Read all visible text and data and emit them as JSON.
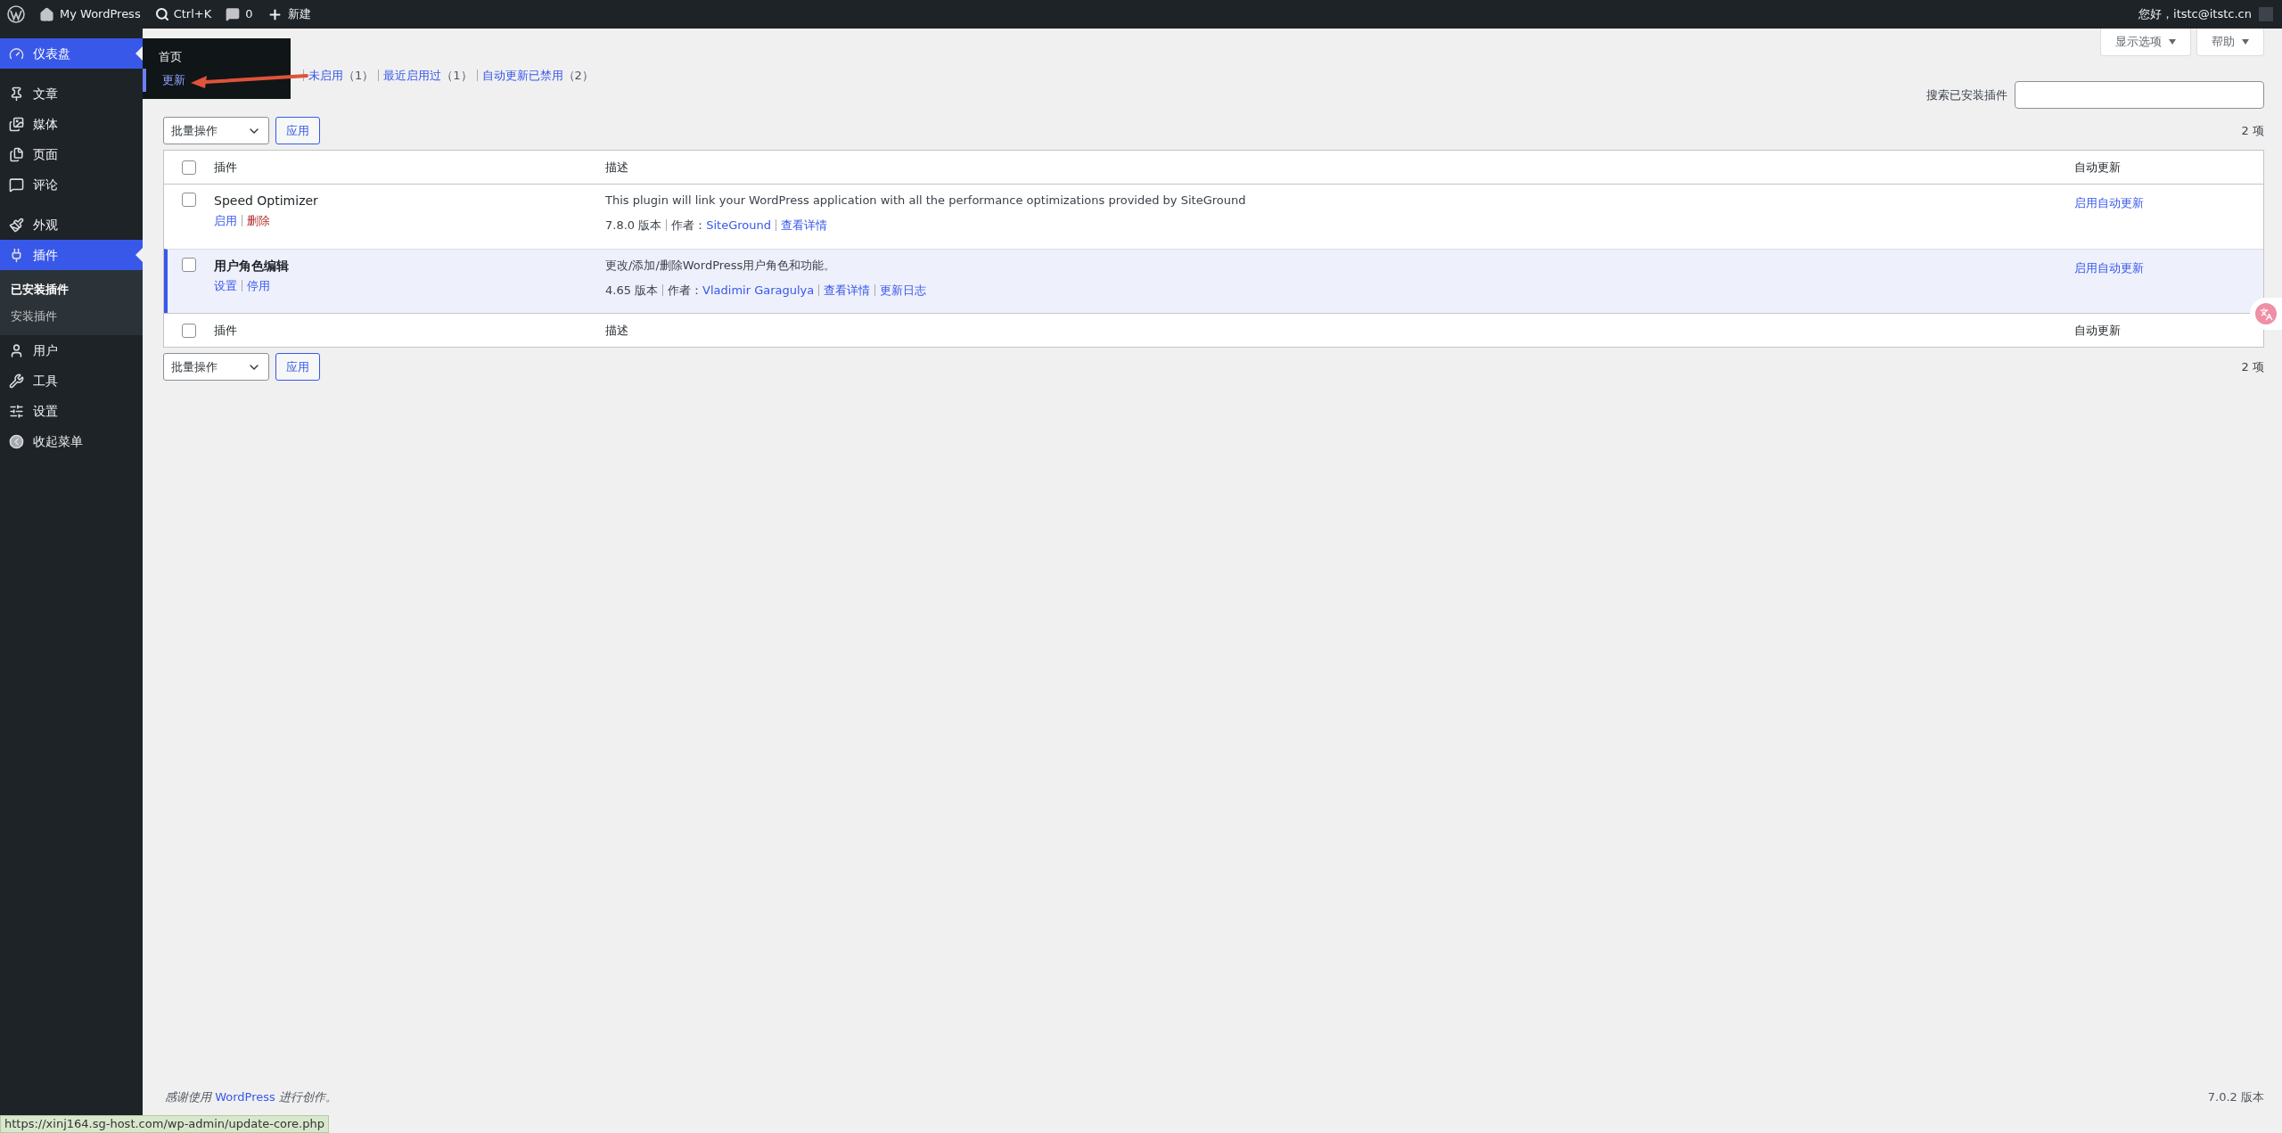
{
  "admin_bar": {
    "site": "My WordPress",
    "search_shortcut": "Ctrl+K",
    "comments": "0",
    "new": "新建",
    "greeting": "您好，itstc@itstc.cn"
  },
  "sidebar": {
    "groups": [
      {
        "items": [
          {
            "label": "仪表盘",
            "highlighted": true
          }
        ]
      },
      {
        "items": [
          {
            "label": "文章",
            "highlighted": false
          },
          {
            "label": "媒体",
            "highlighted": false
          },
          {
            "label": "页面",
            "highlighted": false
          },
          {
            "label": "评论",
            "highlighted": false
          }
        ]
      },
      {
        "items": [
          {
            "label": "外观",
            "highlighted": false
          },
          {
            "label": "插件",
            "highlighted": true,
            "children": [
              {
                "label": "已安装插件",
                "selected": true
              },
              {
                "label": "安装插件",
                "selected": false
              }
            ]
          },
          {
            "label": "用户",
            "highlighted": false
          },
          {
            "label": "工具",
            "highlighted": false
          },
          {
            "label": "设置",
            "highlighted": false
          },
          {
            "label": "收起菜单",
            "highlighted": false
          }
        ]
      }
    ]
  },
  "flyout": {
    "items": [
      {
        "label": "首页",
        "selected": false
      },
      {
        "label": "更新",
        "selected": true
      }
    ]
  },
  "screen_options": "显示选项",
  "help": "帮助",
  "filters": [
    {
      "label": "未启用",
      "count": "（1）"
    },
    {
      "label": "最近启用过",
      "count": "（1）"
    },
    {
      "label": "自动更新已禁用",
      "count": "（2）"
    }
  ],
  "search": {
    "label": "搜索已安装插件"
  },
  "bulk_top": {
    "select": "批量操作",
    "apply": "应用",
    "count": "2 项"
  },
  "table": {
    "columns": [
      "插件",
      "描述",
      "自动更新"
    ],
    "rows": [
      {
        "name": "Speed Optimizer",
        "active": false,
        "actions": [
          {
            "label": "启用",
            "kind": "link"
          },
          {
            "label": "删除",
            "kind": "delete"
          }
        ],
        "description": "This plugin will link your WordPress application with all the performance optimizations provided by SiteGround",
        "version": "7.8.0 版本",
        "author_label": "作者：",
        "author": "SiteGround",
        "links": [
          "查看详情"
        ],
        "auto_update": "启用自动更新"
      },
      {
        "name": "用户角色编辑",
        "active": true,
        "actions": [
          {
            "label": "设置",
            "kind": "link"
          },
          {
            "label": "停用",
            "kind": "link"
          }
        ],
        "description": "更改/添加/删除WordPress用户角色和功能。",
        "version": "4.65 版本",
        "author_label": "作者：",
        "author": "Vladimir Garagulya",
        "links": [
          "查看详情",
          "更新日志"
        ],
        "auto_update": "启用自动更新"
      }
    ],
    "footer_columns": [
      "插件",
      "描述",
      "自动更新"
    ],
    "header_checked": false,
    "footer_checked": false
  },
  "bulk_bottom": {
    "select": "批量操作",
    "apply": "应用",
    "count": "2 项"
  },
  "footer": {
    "before": "感谢使用",
    "link": "WordPress",
    "after": "进行创作。",
    "version": "7.0.2 版本"
  },
  "status_url": "https://xinj164.sg-host.com/wp-admin/update-core.php"
}
